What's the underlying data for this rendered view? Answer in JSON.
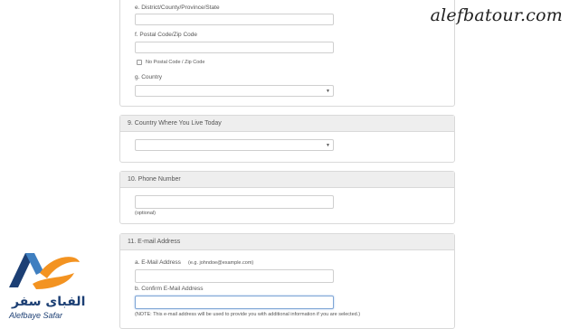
{
  "watermark": "alefbatour.com",
  "logo": {
    "text_fa": "الفبای سفر",
    "text_en": "Alefbaye Safar",
    "colors": {
      "orange": "#f39321",
      "blue": "#1c3f74",
      "lightblue": "#3f7fc0"
    }
  },
  "address_section": {
    "district_label": "e. District/County/Province/State",
    "district_value": "",
    "postal_label": "f. Postal Code/Zip Code",
    "postal_value": "",
    "no_postal_label": "No Postal Code / Zip Code",
    "country_label": "g. Country",
    "country_value": ""
  },
  "section9": {
    "title": "9. Country Where You Live Today",
    "country_value": ""
  },
  "section10": {
    "title": "10. Phone Number",
    "phone_value": "",
    "optional_text": "(optional)"
  },
  "section11": {
    "title": "11. E-mail Address",
    "email_label": "a. E-Mail Address",
    "email_example": "(e.g. johndoe@example.com)",
    "email_value": "",
    "confirm_label": "b. Confirm E-Mail Address",
    "confirm_value": "",
    "note": "(NOTE: This e-mail address will be used to provide you with additional information if you are selected.)"
  },
  "icons": {
    "dropdown_caret": "▼"
  }
}
